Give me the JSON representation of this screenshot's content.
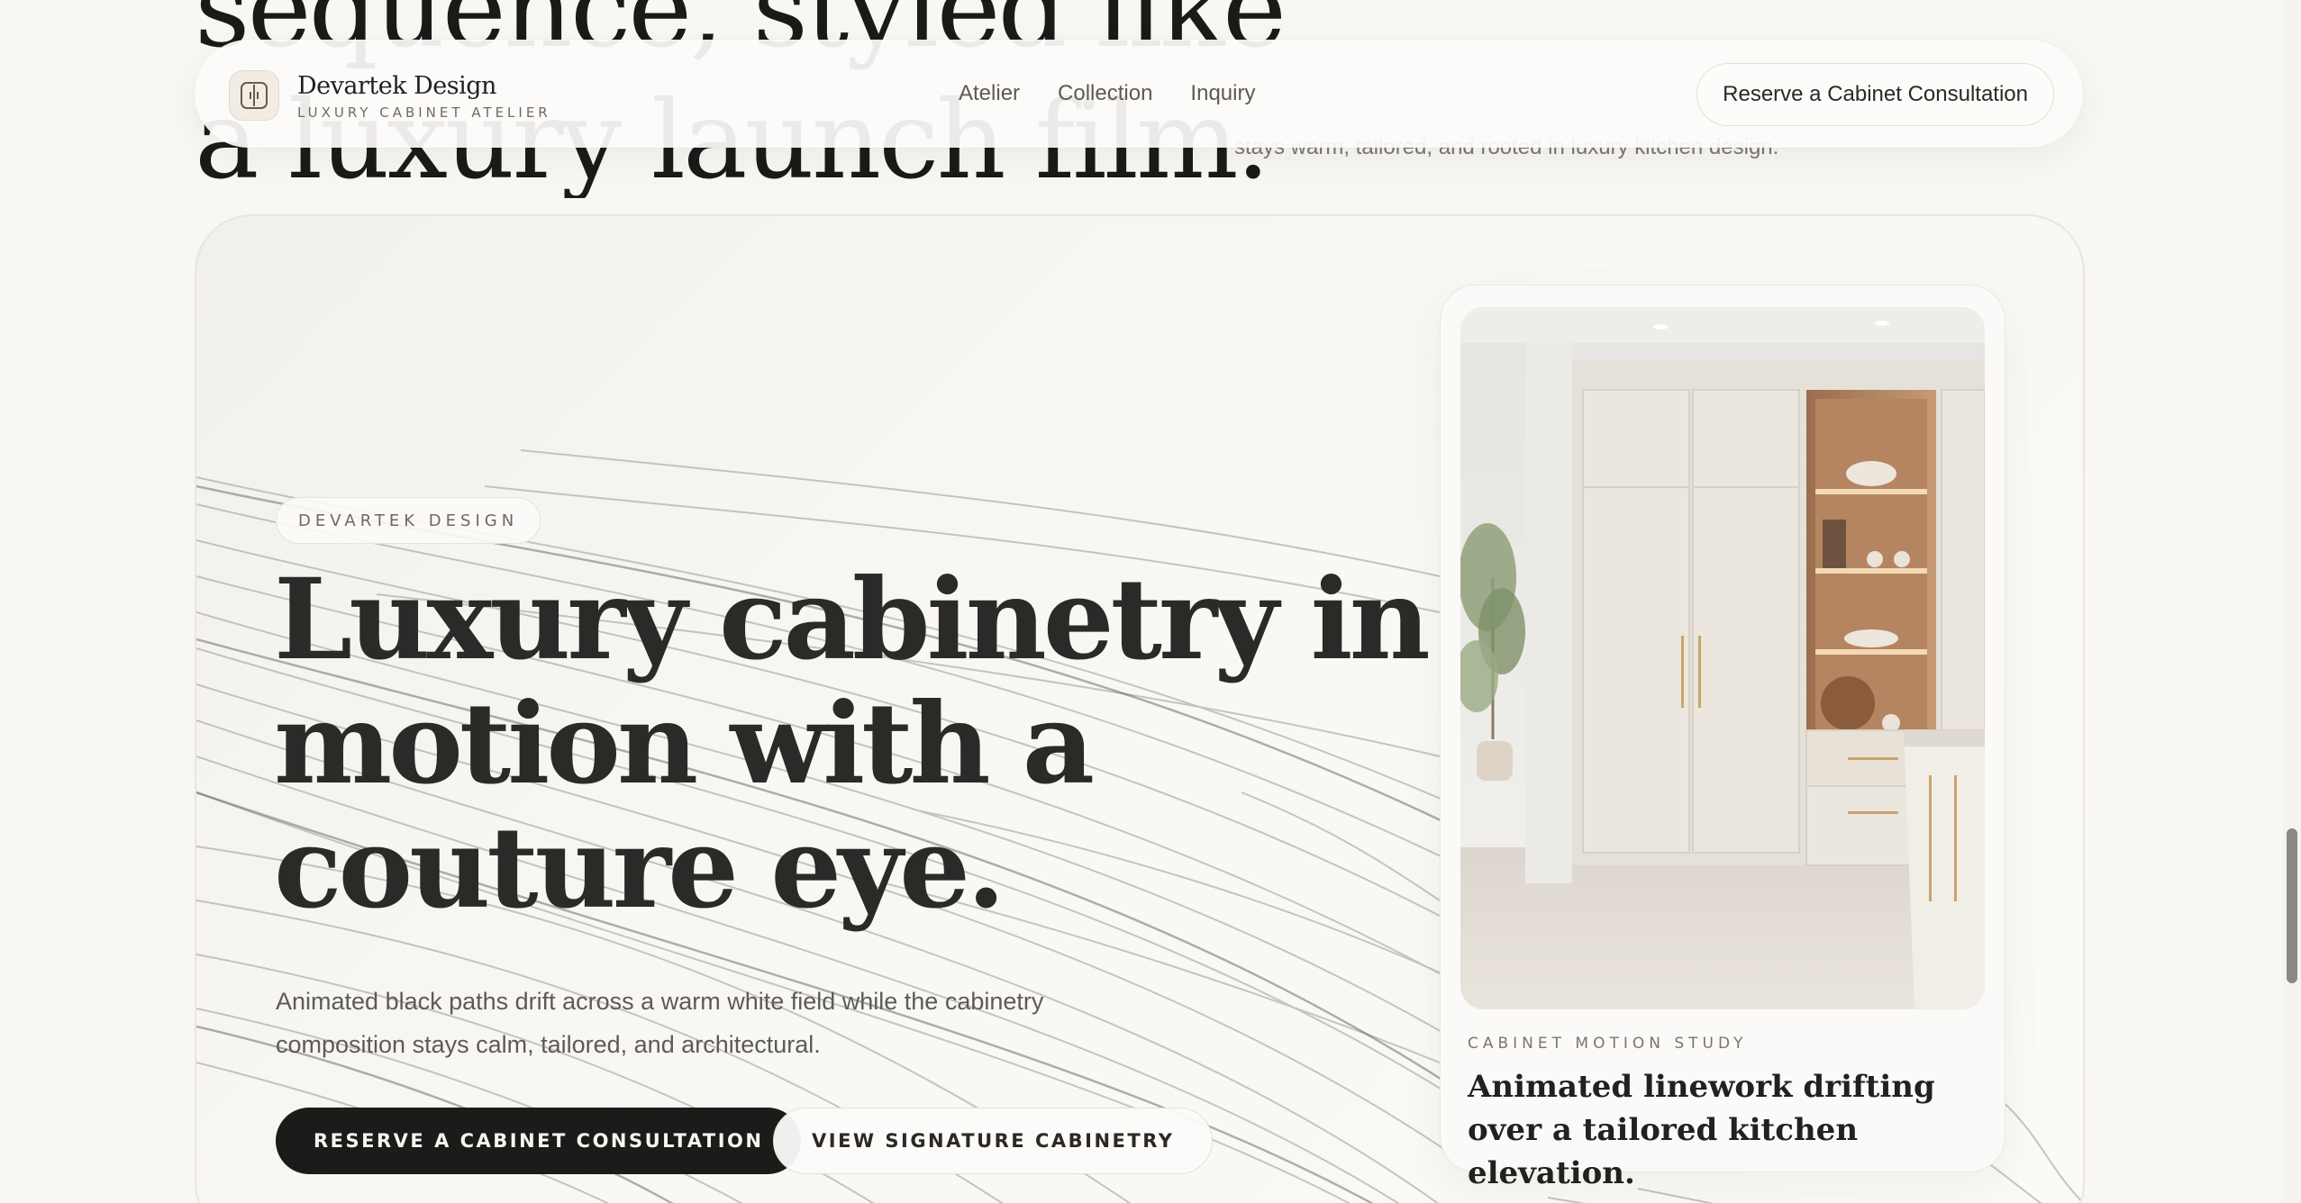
{
  "previous_section": {
    "headline_line1": "sequence, styled like",
    "headline_line2": "a luxury launch film.",
    "subtext": "stays warm, tailored, and rooted in luxury kitchen design."
  },
  "header": {
    "brand_name": "Devartek Design",
    "brand_tagline": "LUXURY CABINET ATELIER",
    "nav": [
      "Atelier",
      "Collection",
      "Inquiry"
    ],
    "cta_label": "Reserve a Cabinet Consultation"
  },
  "hero": {
    "eyebrow": "DEVARTEK DESIGN",
    "title_lines": [
      "Luxury cabinetry in",
      "motion with a",
      "couture eye."
    ],
    "subtitle": "Animated black paths drift across a warm white field while the cabinetry composition stays calm, tailored, and architectural.",
    "primary_button": "RESERVE A CABINET CONSULTATION",
    "secondary_button": "VIEW SIGNATURE CABINETRY"
  },
  "feature_card": {
    "eyebrow": "CABINET MOTION STUDY",
    "title": "Animated linework drifting over a tailored kitchen elevation."
  },
  "colors": {
    "background": "#f8f7f3",
    "ink": "#1c1b1a",
    "wood": "#b48560",
    "brass": "#c9a46b"
  }
}
